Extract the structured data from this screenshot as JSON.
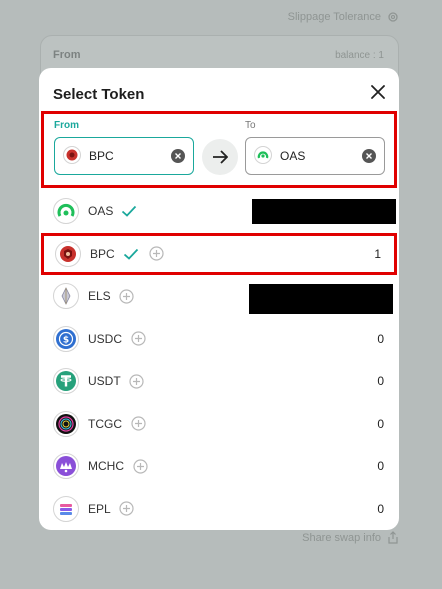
{
  "background": {
    "slippage_label": "Slippage Tolerance",
    "from_label": "From",
    "balance_label": "balance : 1",
    "share_label": "Share swap info"
  },
  "modal": {
    "title": "Select Token",
    "from_label": "From",
    "to_label": "To",
    "from_token": "BPC",
    "to_token": "OAS"
  },
  "tokens": [
    {
      "symbol": "OAS",
      "status": "added",
      "balance": ""
    },
    {
      "symbol": "BPC",
      "status": "added",
      "balance": "1"
    },
    {
      "symbol": "ELS",
      "status": "add",
      "balance": ""
    },
    {
      "symbol": "USDC",
      "status": "add",
      "balance": "0"
    },
    {
      "symbol": "USDT",
      "status": "add",
      "balance": "0"
    },
    {
      "symbol": "TCGC",
      "status": "add",
      "balance": "0"
    },
    {
      "symbol": "MCHC",
      "status": "add",
      "balance": "0"
    },
    {
      "symbol": "EPL",
      "status": "add",
      "balance": "0"
    }
  ],
  "colors": {
    "accent": "#1aa89c",
    "highlight": "#e00000"
  }
}
